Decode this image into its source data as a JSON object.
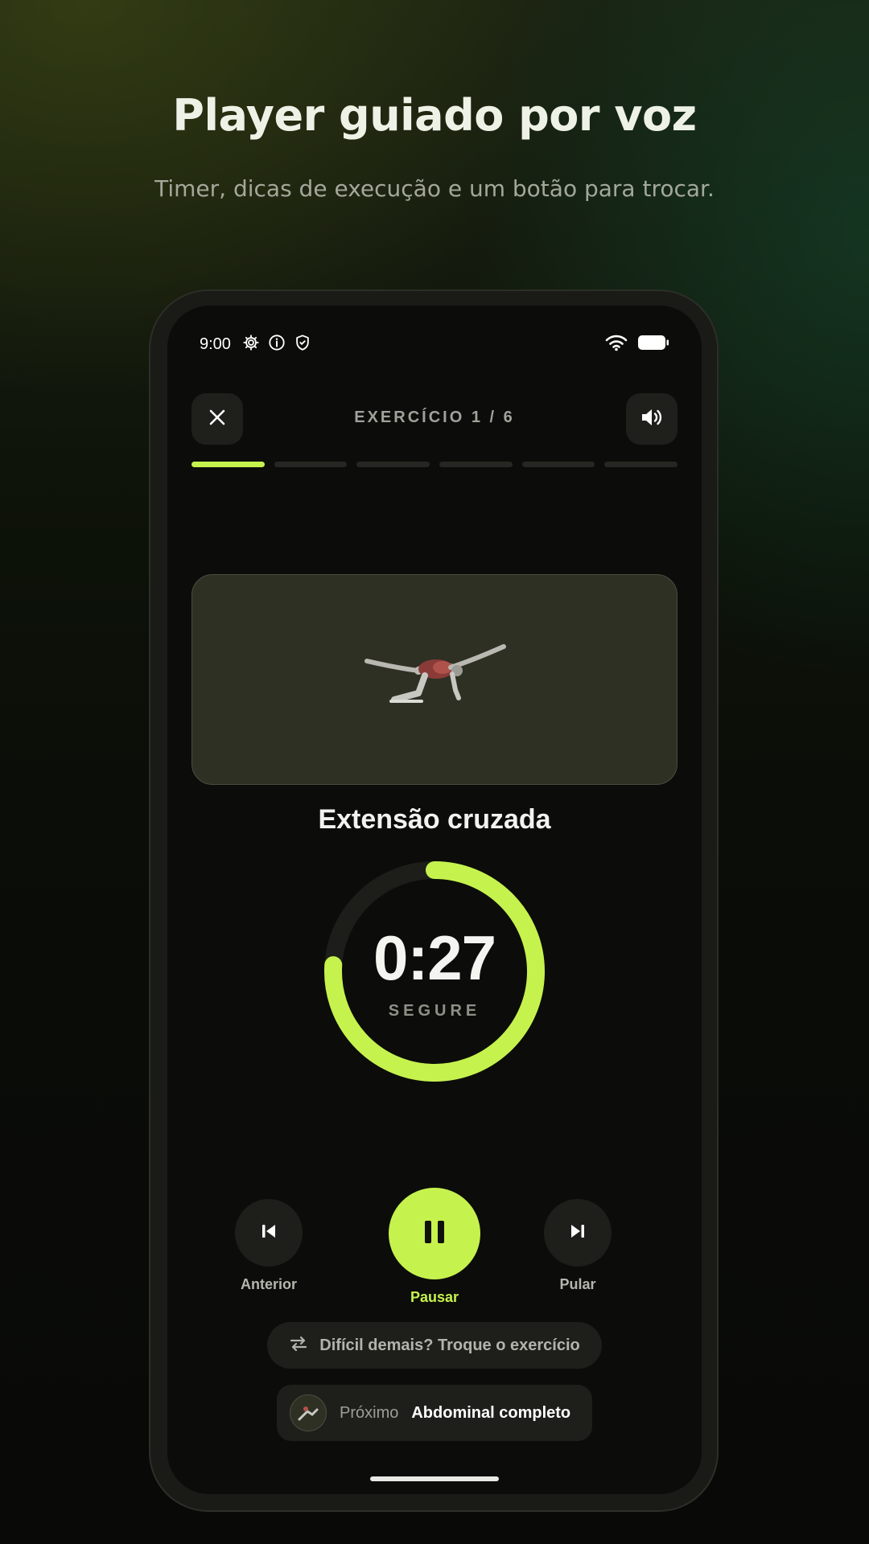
{
  "promo": {
    "title": "Player guiado por voz",
    "subtitle": "Timer, dicas de execução e um botão para trocar."
  },
  "status_bar": {
    "time": "9:00",
    "left_icons": [
      "gear-icon",
      "info-icon",
      "shield-icon"
    ],
    "right_icons": [
      "wifi-icon",
      "battery-icon"
    ]
  },
  "header": {
    "close_icon": "close-icon",
    "counter": "EXERCÍCIO 1 / 6",
    "sound_icon": "volume-icon"
  },
  "progress": {
    "total_segments": 6,
    "current_segment": 1
  },
  "exercise": {
    "name": "Extensão cruzada",
    "timer": "0:27",
    "timer_label": "SEGURE",
    "ring_progress": 0.76
  },
  "controls": {
    "previous_label": "Anterior",
    "pause_label": "Pausar",
    "skip_label": "Pular"
  },
  "swap": {
    "label": "Difícil demais? Troque o exercício",
    "icon": "swap-arrows-icon"
  },
  "next": {
    "label": "Próximo",
    "value": "Abdominal completo"
  },
  "colors": {
    "accent": "#c6f24e",
    "screen_bg": "#0c0d0a",
    "card_bg": "#1e1f1b"
  }
}
